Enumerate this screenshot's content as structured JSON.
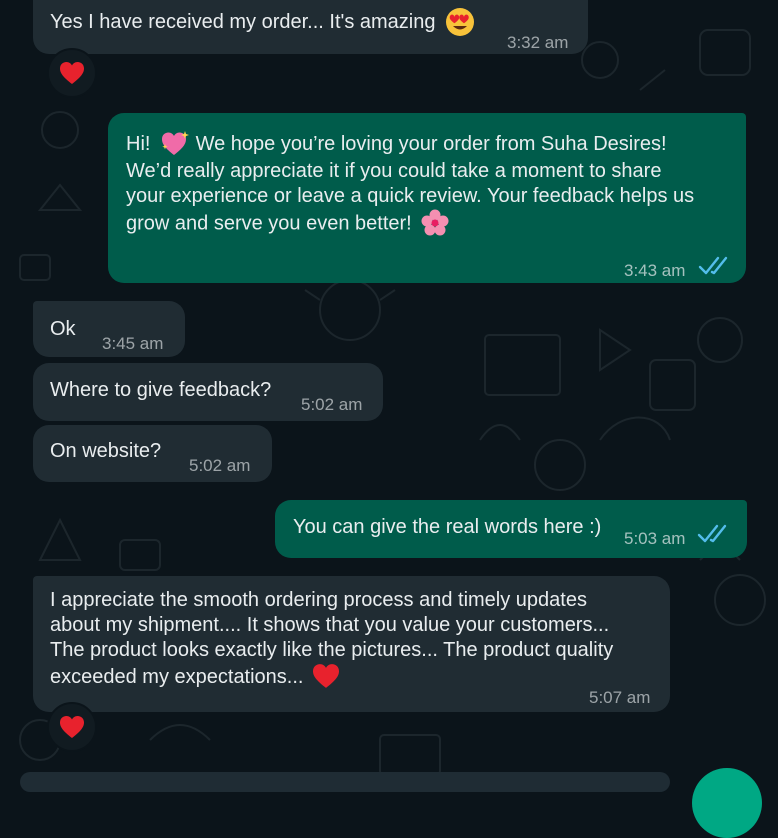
{
  "chat": {
    "messages": [
      {
        "dir": "in",
        "text": "Yes I have received my order... It's amazing",
        "emoji": "heart-eyes-emoji",
        "time": "3:32 am",
        "reaction": "heart-emoji"
      },
      {
        "dir": "out",
        "greeting": "Hi!",
        "greeting_emoji": "sparkling-heart-emoji",
        "text": "We hope you’re loving your order from Suha Desires!\nWe’d really appreciate it if you could take a moment to share\nyour experience or leave a quick review. Your feedback helps us\ngrow and serve you even better!",
        "emoji": "cherry-blossom-emoji",
        "time": "3:43 am",
        "status": "read"
      },
      {
        "dir": "in",
        "text": "Ok",
        "time": "3:45 am"
      },
      {
        "dir": "in",
        "text": "Where to give feedback?",
        "time": "5:02 am"
      },
      {
        "dir": "in",
        "text": "On website?",
        "time": "5:02 am"
      },
      {
        "dir": "out",
        "text": "You can give the real words here :)",
        "time": "5:03 am",
        "status": "read"
      },
      {
        "dir": "in",
        "text": "I appreciate the smooth ordering process and timely updates\nabout my shipment.... It shows that you value your customers...\nThe product looks exactly like the pictures... The product quality\nexceeded my expectations...",
        "emoji": "heart-emoji",
        "time": "5:07 am",
        "reaction": "heart-emoji"
      }
    ]
  },
  "colors": {
    "background": "#0b141a",
    "incoming_bubble": "#202c33",
    "outgoing_bubble": "#005c4b",
    "read_ticks": "#53bdeb",
    "accent": "#00a884",
    "heart": "#e8222d"
  }
}
